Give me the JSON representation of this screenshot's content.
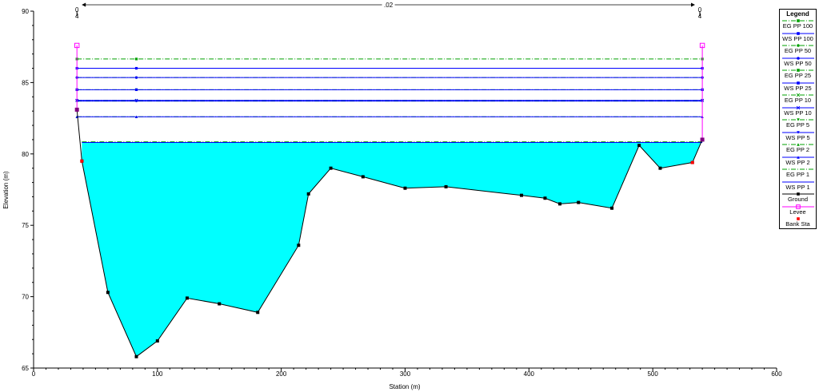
{
  "chart_data": {
    "type": "area",
    "xlabel": "Station (m)",
    "ylabel": "Elevation (m)",
    "xlim": [
      0,
      600
    ],
    "ylim": [
      65,
      90
    ],
    "x_ticks": [
      0,
      100,
      200,
      300,
      400,
      500,
      600
    ],
    "y_ticks": [
      65,
      70,
      75,
      80,
      85,
      90
    ],
    "grid": false,
    "legend_position": "right",
    "legend_title": "Legend",
    "manning_n": [
      {
        "station": 35,
        "label_top": "0",
        "label_bottom": "4"
      },
      {
        "station": 538,
        "label_top": "0",
        "label_bottom": "4"
      }
    ],
    "manning_span_label": ".02",
    "water_fill_color": "#00ffff",
    "ground": {
      "name": "Ground",
      "color": "#000000",
      "x": [
        35,
        39,
        60,
        83,
        100,
        124,
        150,
        181,
        214,
        222,
        240,
        266,
        300,
        333,
        394,
        413,
        425,
        440,
        467,
        489,
        506,
        532,
        540
      ],
      "y": [
        83.1,
        79.5,
        70.3,
        65.8,
        66.9,
        69.9,
        69.5,
        68.9,
        73.6,
        77.2,
        79.0,
        78.4,
        77.6,
        77.7,
        77.1,
        76.9,
        76.5,
        76.6,
        76.2,
        80.6,
        79.0,
        79.4,
        81.0
      ]
    },
    "water_surface": {
      "name": "WS PP 1",
      "elevation": 80.8,
      "x_left": 39,
      "x_right": 540
    },
    "profiles": [
      {
        "name": "EG PP 100",
        "y": 86.65,
        "color": "#00a000",
        "marker": "square"
      },
      {
        "name": "WS PP 100",
        "y": 86.0,
        "color": "#0000ff",
        "marker": "square"
      },
      {
        "name": "EG PP 50",
        "y": 85.35,
        "color": "#00a000",
        "marker": "circle"
      },
      {
        "name": "WS PP 50",
        "y": 85.35,
        "color": "#0000ff",
        "marker": "circle"
      },
      {
        "name": "EG PP 25",
        "y": 84.5,
        "color": "#00a000",
        "marker": "square"
      },
      {
        "name": "WS PP 25",
        "y": 84.5,
        "color": "#0000ff",
        "marker": "square"
      },
      {
        "name": "EG PP 10",
        "y": 83.75,
        "color": "#00a000",
        "marker": "x"
      },
      {
        "name": "WS PP 10",
        "y": 83.75,
        "color": "#0000ff",
        "marker": "x"
      },
      {
        "name": "EG PP 5",
        "y": 83.7,
        "color": "#00a000",
        "marker": "triangle-down"
      },
      {
        "name": "WS PP 5",
        "y": 83.7,
        "color": "#0000ff",
        "marker": "triangle-down"
      },
      {
        "name": "EG PP 2",
        "y": 82.6,
        "color": "#00a000",
        "marker": "triangle"
      },
      {
        "name": "WS PP 2",
        "y": 82.6,
        "color": "#0000ff",
        "marker": "triangle"
      },
      {
        "name": "EG PP 1",
        "y": 80.85,
        "color": "#00a000",
        "marker": "none"
      },
      {
        "name": "WS PP 1",
        "y": 80.8,
        "color": "#0000ff",
        "marker": "none"
      }
    ],
    "levees": [
      {
        "name": "Levee",
        "color": "#ff00ff",
        "station": 35,
        "top": 87.6,
        "bottom": 83.1
      },
      {
        "name": "Levee",
        "color": "#ff00ff",
        "station": 540,
        "top": 87.6,
        "bottom": 81.0
      }
    ],
    "bank_stations": [
      {
        "name": "Bank Sta",
        "color": "#ff0000",
        "x": 39,
        "y": 79.5
      },
      {
        "name": "Bank Sta",
        "color": "#ff0000",
        "x": 532,
        "y": 79.4
      }
    ],
    "legend": [
      {
        "label": "EG PP 100",
        "color": "#00a000",
        "style": "dash-dot",
        "marker": "square"
      },
      {
        "label": "WS PP 100",
        "color": "#0000ff",
        "style": "solid",
        "marker": "square"
      },
      {
        "label": "EG PP 50",
        "color": "#00a000",
        "style": "dash-dot",
        "marker": "circle"
      },
      {
        "label": "WS PP 50",
        "color": "#0000ff",
        "style": "solid",
        "marker": "circle"
      },
      {
        "label": "EG PP 25",
        "color": "#00a000",
        "style": "dash-dot",
        "marker": "square"
      },
      {
        "label": "WS PP 25",
        "color": "#0000ff",
        "style": "solid",
        "marker": "square"
      },
      {
        "label": "EG PP 10",
        "color": "#00a000",
        "style": "dash-dot",
        "marker": "x"
      },
      {
        "label": "WS PP 10",
        "color": "#0000ff",
        "style": "solid",
        "marker": "x"
      },
      {
        "label": "EG PP 5",
        "color": "#00a000",
        "style": "dash-dot",
        "marker": "triangle-down"
      },
      {
        "label": "WS PP 5",
        "color": "#0000ff",
        "style": "solid",
        "marker": "triangle-down"
      },
      {
        "label": "EG PP 2",
        "color": "#00a000",
        "style": "dash-dot",
        "marker": "triangle"
      },
      {
        "label": "WS PP 2",
        "color": "#0000ff",
        "style": "solid",
        "marker": "triangle"
      },
      {
        "label": "EG PP 1",
        "color": "#00a000",
        "style": "dash-dot",
        "marker": "none"
      },
      {
        "label": "WS PP 1",
        "color": "#0000ff",
        "style": "solid",
        "marker": "none"
      },
      {
        "label": "Ground",
        "color": "#000000",
        "style": "solid",
        "marker": "square"
      },
      {
        "label": "Levee",
        "color": "#ff00ff",
        "style": "solid",
        "marker": "open-square"
      },
      {
        "label": "Bank Sta",
        "color": "#ff0000",
        "style": "none",
        "marker": "square"
      }
    ]
  }
}
